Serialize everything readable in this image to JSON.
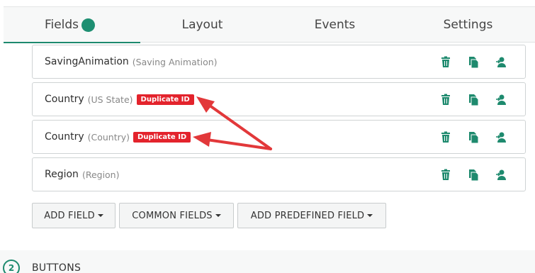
{
  "tabs": [
    {
      "label": "Fields",
      "active": true
    },
    {
      "label": "Layout",
      "active": false
    },
    {
      "label": "Events",
      "active": false
    },
    {
      "label": "Settings",
      "active": false
    }
  ],
  "fields": [
    {
      "name": "SavingAnimation",
      "sub": "(Saving Animation)",
      "badge": ""
    },
    {
      "name": "Country",
      "sub": "(US State)",
      "badge": "Duplicate ID"
    },
    {
      "name": "Country",
      "sub": "(Country)",
      "badge": "Duplicate ID"
    },
    {
      "name": "Region",
      "sub": "(Region)",
      "badge": ""
    }
  ],
  "field_actions": [
    "trash-icon",
    "copy-icon",
    "user-reassign-icon"
  ],
  "buttons": {
    "add_field": "ADD FIELD",
    "common_fields": "COMMON FIELDS",
    "add_predefined_field": "ADD PREDEFINED FIELD"
  },
  "section": {
    "step": "2",
    "title": "BUTTONS"
  },
  "colors": {
    "accent": "#1e8a6e",
    "badge": "#e3232c",
    "arrow": "#e2383a"
  }
}
